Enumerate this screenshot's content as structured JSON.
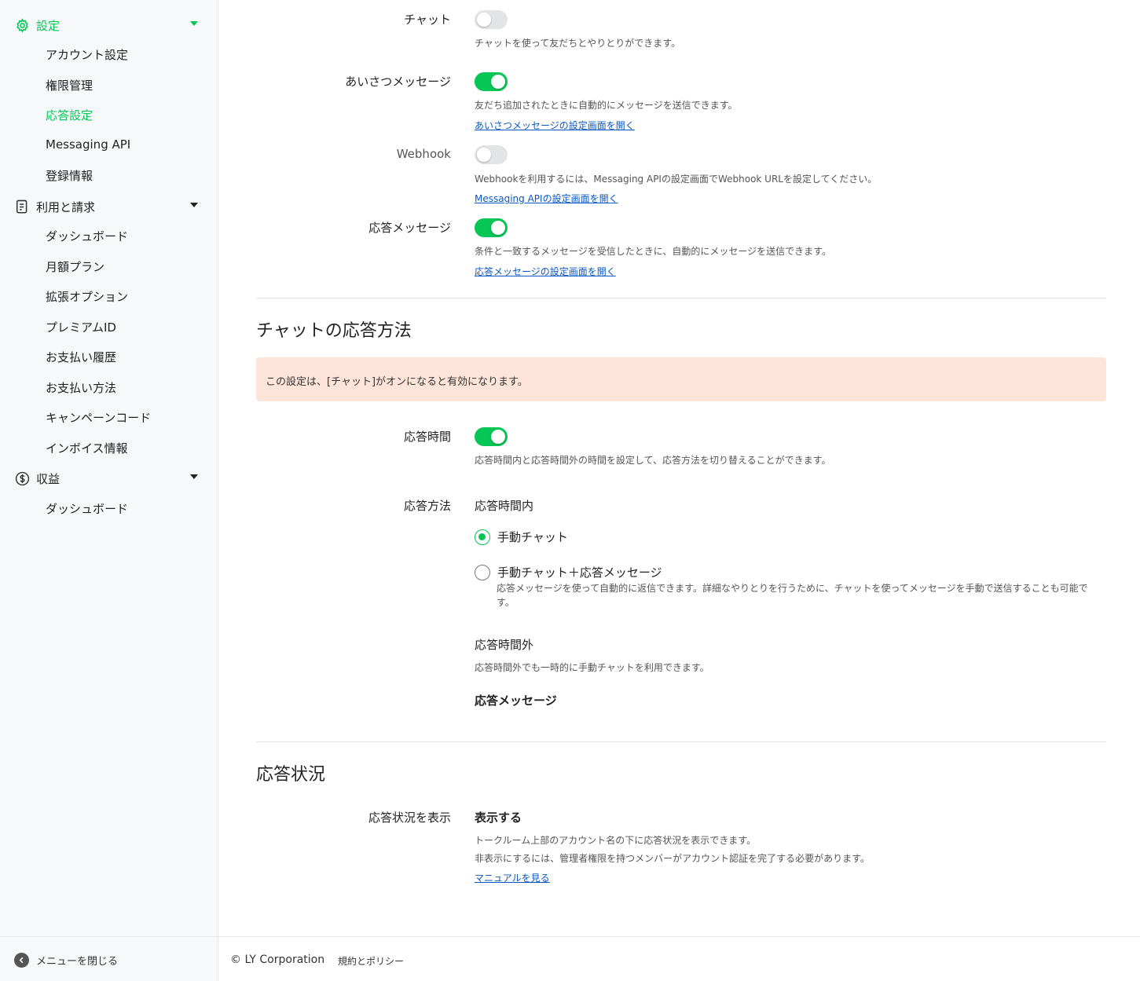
{
  "sidebar": {
    "groups": [
      {
        "label": "設定",
        "icon": "gear-icon"
      },
      {
        "label": "利用と請求",
        "icon": "document-icon"
      },
      {
        "label": "収益",
        "icon": "dollar-coin-icon"
      }
    ],
    "settings_items": [
      "アカウント設定",
      "権限管理",
      "応答設定",
      "Messaging API",
      "登録情報"
    ],
    "billing_items": [
      "ダッシュボード",
      "月額プラン",
      "拡張オプション",
      "プレミアムID",
      "お支払い履歴",
      "お支払い方法",
      "キャンペーンコード",
      "インボイス情報"
    ],
    "revenue_items": [
      "ダッシュボード"
    ],
    "close_menu": "メニューを閉じる",
    "accent_color": "#06c755"
  },
  "features": {
    "chat": {
      "label": "チャット",
      "on": false,
      "desc": "チャットを使って友だちとやりとりができます。"
    },
    "greeting": {
      "label": "あいさつメッセージ",
      "on": true,
      "desc": "友だち追加されたときに自動的にメッセージを送信できます。",
      "link": "あいさつメッセージの設定画面を開く"
    },
    "webhook": {
      "label": "Webhook",
      "on": false,
      "desc": "Webhookを利用するには、Messaging APIの設定画面でWebhook URLを設定してください。",
      "link": "Messaging APIの設定画面を開く"
    },
    "auto_reply": {
      "label": "応答メッセージ",
      "on": true,
      "desc": "条件と一致するメッセージを受信したときに、自動的にメッセージを送信できます。",
      "link": "応答メッセージの設定画面を開く"
    }
  },
  "chat_response": {
    "title": "チャットの応答方法",
    "notice": "この設定は、[チャット]がオンになると有効になります。",
    "hours": {
      "label": "応答時間",
      "on": true,
      "desc": "応答時間内と応答時間外の時間を設定して、応答方法を切り替えることができます。"
    },
    "method_label": "応答方法",
    "within_hours": "応答時間内",
    "options": [
      {
        "label": "手動チャット",
        "checked": true
      },
      {
        "label": "手動チャット＋応答メッセージ",
        "checked": false,
        "desc": "応答メッセージを使って自動的に返信できます。詳細なやりとりを行うために、チャットを使ってメッセージを手動で送信することも可能です。"
      }
    ],
    "outside_hours": "応答時間外",
    "outside_desc": "応答時間外でも一時的に手動チャットを利用できます。",
    "outside_value": "応答メッセージ"
  },
  "status": {
    "title": "応答状況",
    "label": "応答状況を表示",
    "value": "表示する",
    "desc1": "トークルーム上部のアカウント名の下に応答状況を表示できます。",
    "desc2": "非表示にするには、管理者権限を持つメンバーがアカウント認証を完了する必要があります。",
    "link": "マニュアルを見る"
  },
  "footer": {
    "copyright": "© LY Corporation",
    "policy": "規約とポリシー"
  }
}
